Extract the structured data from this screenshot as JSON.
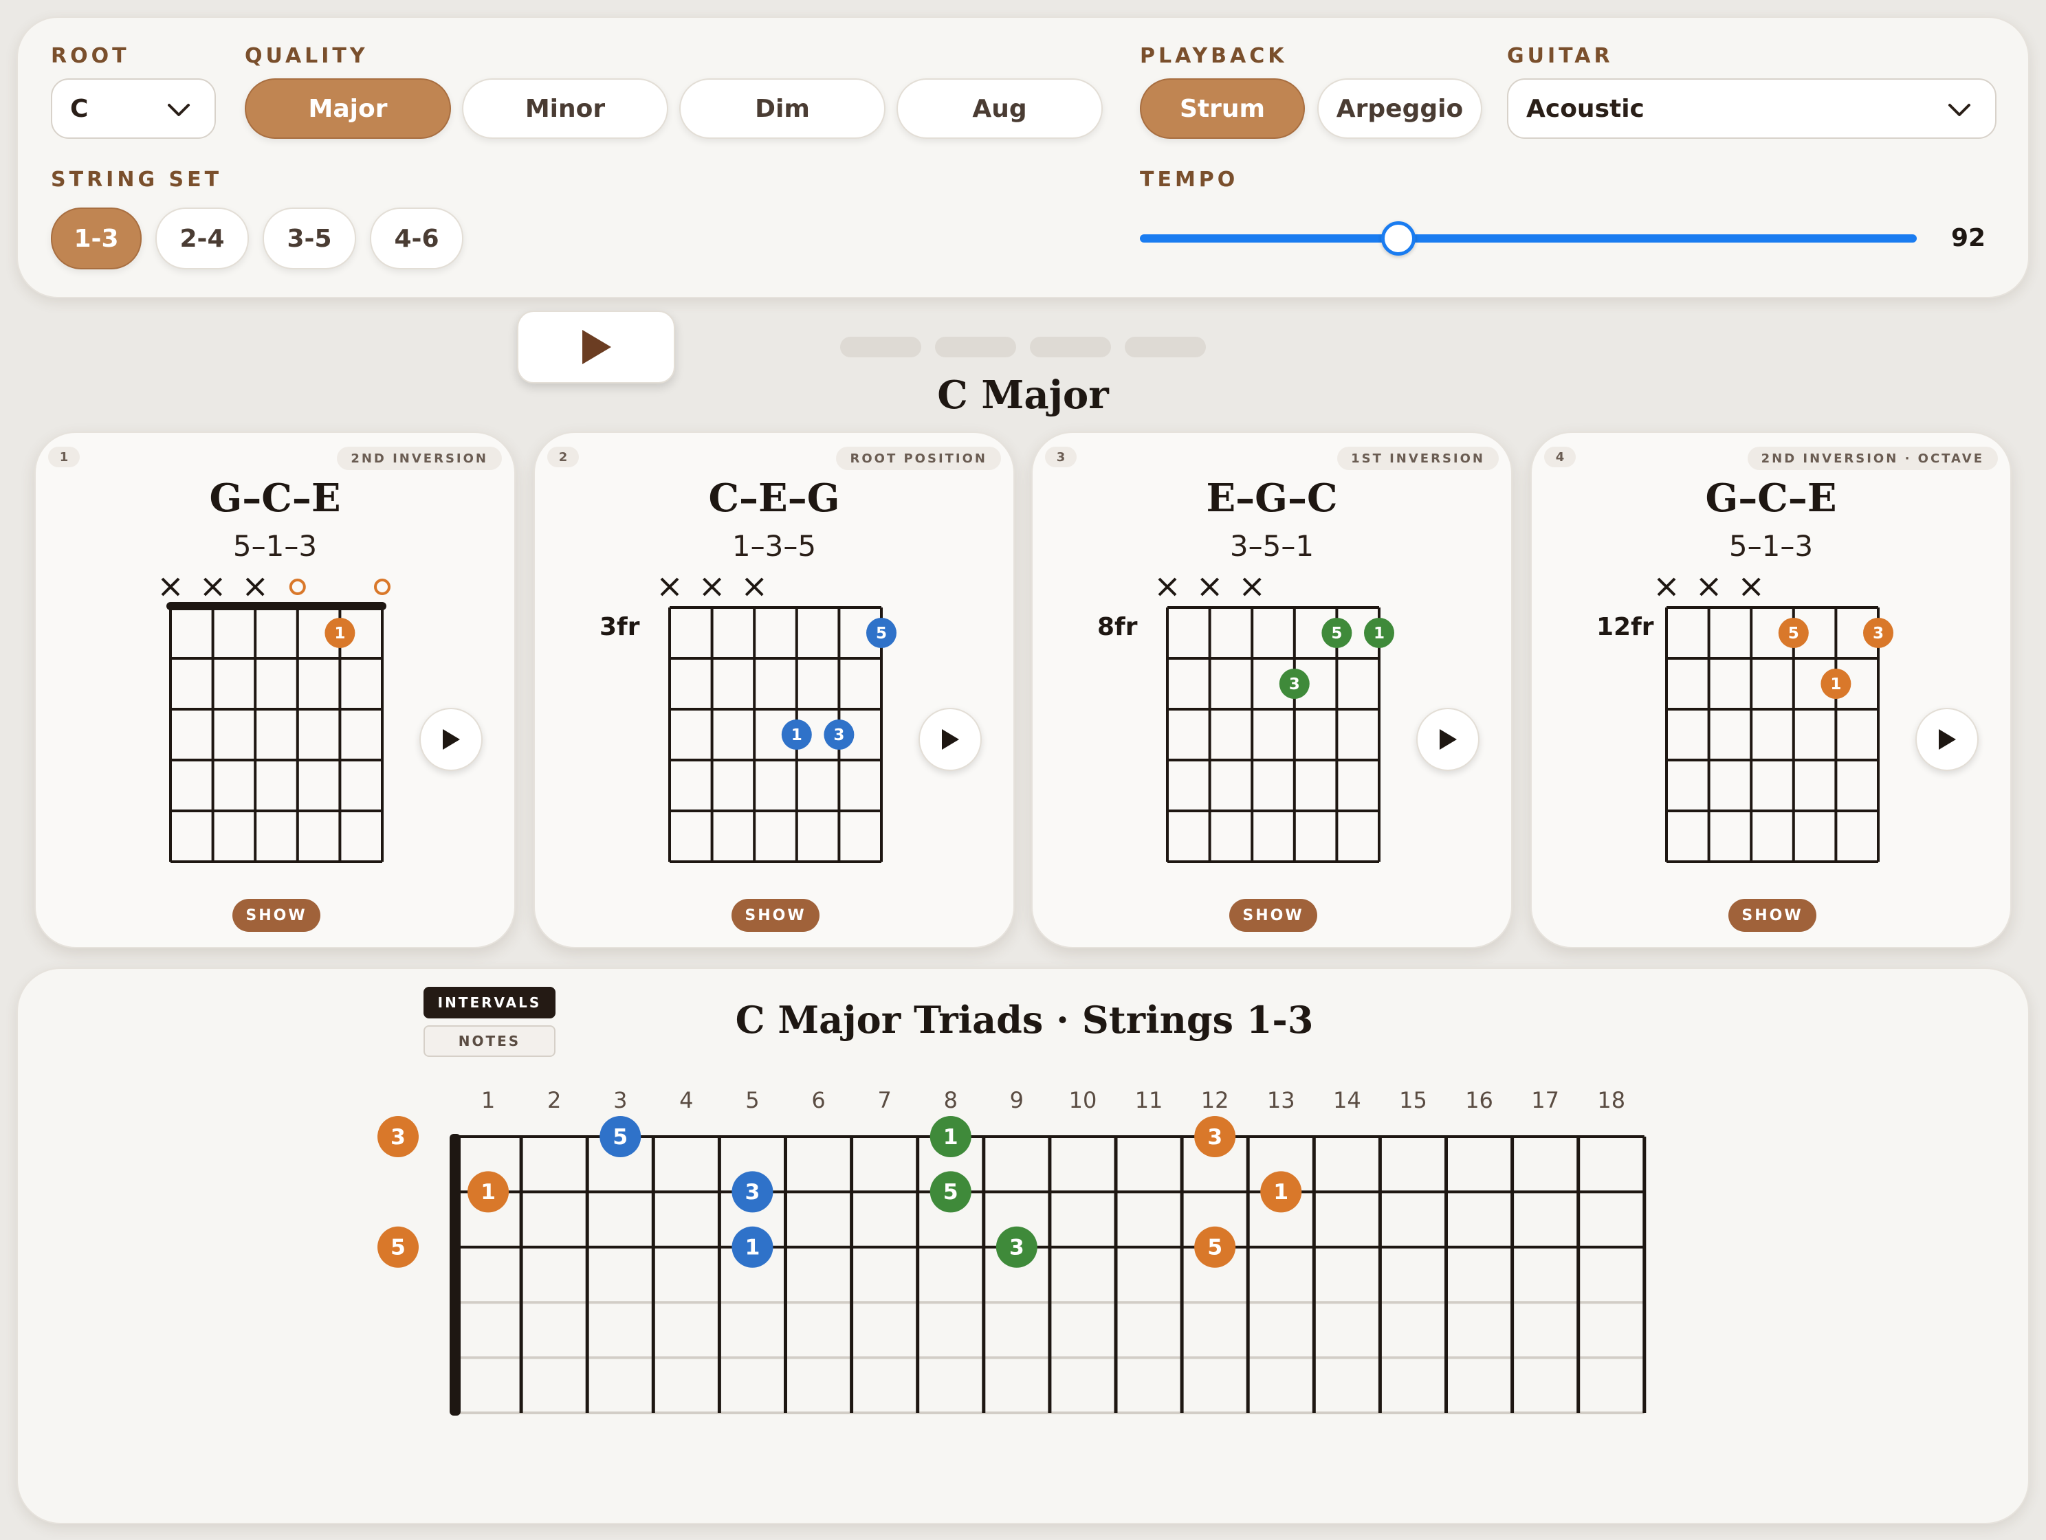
{
  "controls": {
    "root_label": "ROOT",
    "root_value": "C",
    "quality_label": "QUALITY",
    "quality_options": [
      "Major",
      "Minor",
      "Dim",
      "Aug"
    ],
    "quality_selected": "Major",
    "string_set_label": "STRING SET",
    "string_sets": [
      "1-3",
      "2-4",
      "3-5",
      "4-6"
    ],
    "string_set_selected": "1-3",
    "playback_label": "PLAYBACK",
    "playback_options": [
      "Strum",
      "Arpeggio"
    ],
    "playback_selected": "Strum",
    "guitar_label": "GUITAR",
    "guitar_value": "Acoustic",
    "tempo_label": "TEMPO",
    "tempo_value": "92",
    "tempo_fraction": 0.333
  },
  "heading": "C Major",
  "colors": {
    "accent": "#c08552",
    "root_orange": "#d9782a",
    "third_blue": "#2f72c9",
    "fifth_green": "#3f8a3a",
    "show_brown": "#a0623a",
    "slider_blue": "#1a7cf0"
  },
  "cards": [
    {
      "num": "1",
      "tag": "2ND INVERSION",
      "title": "G–C–E",
      "sub": "5–1–3",
      "fret_label": "",
      "markers": [
        "x",
        "x",
        "x",
        "o",
        "",
        "o"
      ],
      "nut": true,
      "dots": [
        {
          "s": 5,
          "f": 1,
          "l": "1",
          "c": "o"
        }
      ],
      "show": "SHOW"
    },
    {
      "num": "2",
      "tag": "ROOT POSITION",
      "title": "C–E–G",
      "sub": "1–3–5",
      "fret_label": "3fr",
      "markers": [
        "x",
        "x",
        "x",
        "",
        "",
        ""
      ],
      "nut": false,
      "dots": [
        {
          "s": 6,
          "f": 1,
          "l": "5",
          "c": "b"
        },
        {
          "s": 4,
          "f": 3,
          "l": "1",
          "c": "b"
        },
        {
          "s": 5,
          "f": 3,
          "l": "3",
          "c": "b"
        }
      ],
      "show": "SHOW"
    },
    {
      "num": "3",
      "tag": "1ST INVERSION",
      "title": "E–G–C",
      "sub": "3–5–1",
      "fret_label": "8fr",
      "markers": [
        "x",
        "x",
        "x",
        "",
        "",
        ""
      ],
      "nut": false,
      "dots": [
        {
          "s": 5,
          "f": 1,
          "l": "5",
          "c": "g"
        },
        {
          "s": 6,
          "f": 1,
          "l": "1",
          "c": "g"
        },
        {
          "s": 4,
          "f": 2,
          "l": "3",
          "c": "g"
        }
      ],
      "show": "SHOW"
    },
    {
      "num": "4",
      "tag": "2ND INVERSION · OCTAVE",
      "title": "G–C–E",
      "sub": "5–1–3",
      "fret_label": "12fr",
      "markers": [
        "x",
        "x",
        "x",
        "",
        "",
        ""
      ],
      "nut": false,
      "dots": [
        {
          "s": 4,
          "f": 1,
          "l": "5",
          "c": "o"
        },
        {
          "s": 6,
          "f": 1,
          "l": "3",
          "c": "o"
        },
        {
          "s": 5,
          "f": 2,
          "l": "1",
          "c": "o"
        }
      ],
      "show": "SHOW"
    }
  ],
  "fretboard": {
    "title": "C Major Triads · Strings 1-3",
    "toggle_intervals": "INTERVALS",
    "toggle_notes": "NOTES",
    "fret_numbers": [
      "1",
      "2",
      "3",
      "4",
      "5",
      "6",
      "7",
      "8",
      "9",
      "10",
      "11",
      "12",
      "13",
      "14",
      "15",
      "16",
      "17",
      "18"
    ],
    "open_dots": [
      {
        "s": 1,
        "l": "3",
        "c": "o"
      },
      {
        "s": 3,
        "l": "5",
        "c": "o"
      }
    ],
    "dots": [
      {
        "s": 1,
        "f": 3,
        "l": "5",
        "c": "b"
      },
      {
        "s": 1,
        "f": 8,
        "l": "1",
        "c": "g"
      },
      {
        "s": 1,
        "f": 12,
        "l": "3",
        "c": "o"
      },
      {
        "s": 2,
        "f": 1,
        "l": "1",
        "c": "o"
      },
      {
        "s": 2,
        "f": 5,
        "l": "3",
        "c": "b"
      },
      {
        "s": 2,
        "f": 8,
        "l": "5",
        "c": "g"
      },
      {
        "s": 2,
        "f": 13,
        "l": "1",
        "c": "o"
      },
      {
        "s": 3,
        "f": 5,
        "l": "1",
        "c": "b"
      },
      {
        "s": 3,
        "f": 9,
        "l": "3",
        "c": "g"
      },
      {
        "s": 3,
        "f": 12,
        "l": "5",
        "c": "o"
      }
    ]
  }
}
